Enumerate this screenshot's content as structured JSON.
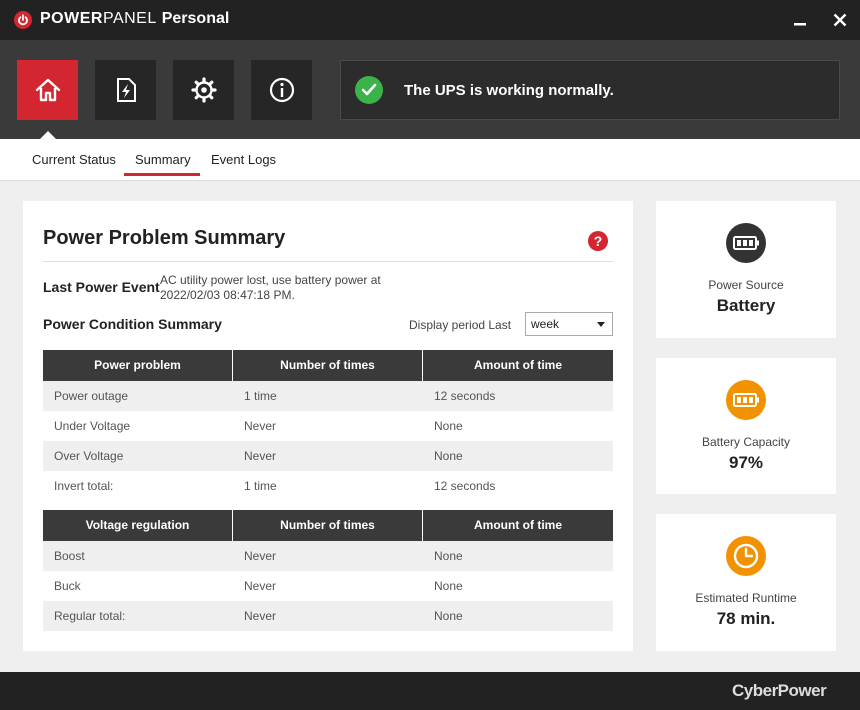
{
  "window": {
    "title_bold": "POWER",
    "title_regular": "PANEL",
    "title_suffix": "Personal"
  },
  "status": {
    "message": "The UPS is working normally.",
    "color": "#3cb34a"
  },
  "nav": [
    {
      "icon": "home-icon",
      "active": true
    },
    {
      "icon": "power-file-icon",
      "active": false
    },
    {
      "icon": "gear-icon",
      "active": false
    },
    {
      "icon": "info-icon",
      "active": false
    }
  ],
  "tabs": [
    {
      "label": "Current Status"
    },
    {
      "label": "Summary",
      "active": true
    },
    {
      "label": "Event Logs"
    }
  ],
  "summary": {
    "title": "Power Problem Summary",
    "help": "?",
    "last_event_label": "Last Power Event",
    "last_event_value": "AC utility power lost, use battery power at 2022/02/03 08:47:18 PM.",
    "condition_label": "Power Condition Summary",
    "period_label": "Display period Last",
    "period_value": "week",
    "power_table": {
      "headers": [
        "Power problem",
        "Number of times",
        "Amount of time"
      ],
      "rows": [
        [
          "Power outage",
          "1 time",
          "12 seconds"
        ],
        [
          "Under Voltage",
          "Never",
          "None"
        ],
        [
          "Over Voltage",
          "Never",
          "None"
        ],
        [
          "Invert total:",
          "1 time",
          "12 seconds"
        ]
      ]
    },
    "voltage_table": {
      "headers": [
        "Voltage regulation",
        "Number of times",
        "Amount of time"
      ],
      "rows": [
        [
          "Boost",
          "Never",
          "None"
        ],
        [
          "Buck",
          "Never",
          "None"
        ],
        [
          "Regular total:",
          "Never",
          "None"
        ]
      ]
    }
  },
  "cards": {
    "source": {
      "label": "Power Source",
      "value": "Battery",
      "icon": "battery-icon"
    },
    "capacity": {
      "label": "Battery Capacity",
      "value": "97%",
      "icon": "battery-level-icon",
      "color": "#f39200"
    },
    "runtime": {
      "label": "Estimated Runtime",
      "value": "78 min.",
      "icon": "clock-icon",
      "color": "#f39200"
    }
  },
  "footer": {
    "brand": "CyberPower"
  },
  "colors": {
    "accent": "#d32630",
    "titlebar": "#222222",
    "toolbar": "#3a3a3a"
  }
}
